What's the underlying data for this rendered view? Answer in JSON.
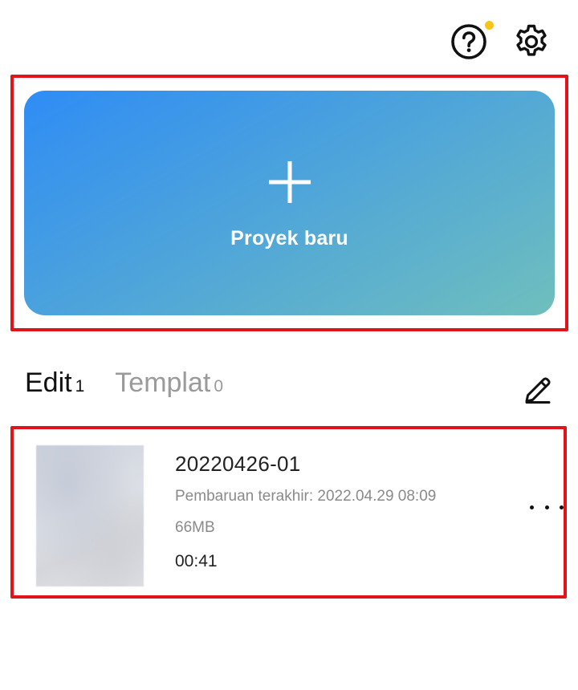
{
  "header": {
    "icons": [
      "help-icon",
      "settings-icon"
    ],
    "notification_dot_color": "#f5c518"
  },
  "new_project": {
    "label": "Proyek baru",
    "icon": "plus-icon",
    "gradient_start": "#2f8cf5",
    "gradient_end": "#6fbfbd"
  },
  "tabs": [
    {
      "label": "Edit",
      "count": "1",
      "active": true
    },
    {
      "label": "Templat",
      "count": "0",
      "active": false
    }
  ],
  "toolbar": {
    "edit_icon": "pencil-icon"
  },
  "projects": [
    {
      "name": "20220426-01",
      "updated": "Pembaruan terakhir: 2022.04.29 08:09",
      "size": "66MB",
      "duration": "00:41"
    }
  ],
  "highlight_color": "#e0141b"
}
